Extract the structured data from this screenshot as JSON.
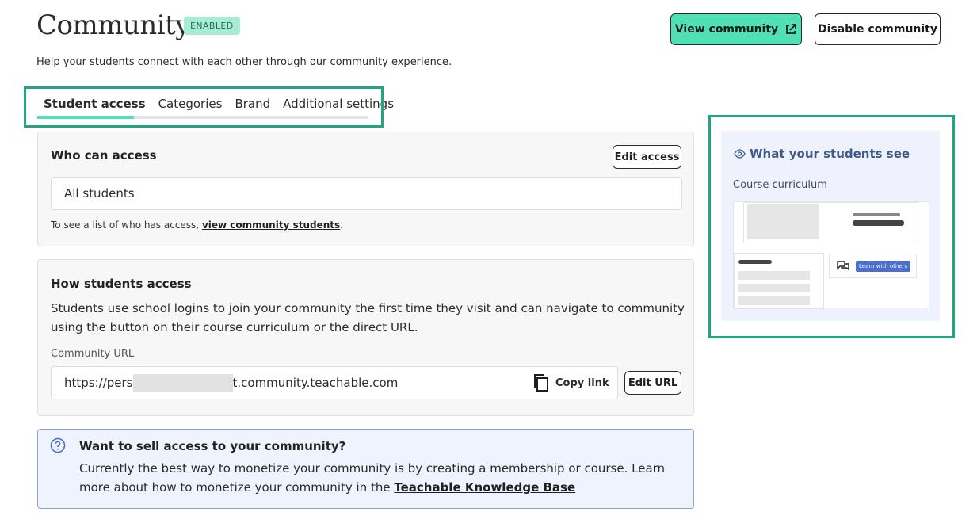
{
  "header": {
    "title": "Community",
    "badge": "ENABLED",
    "subtitle": "Help your students connect with each other through our community experience.",
    "view_button": "View community",
    "disable_button": "Disable community"
  },
  "tabs": [
    {
      "label": "Student access",
      "active": true
    },
    {
      "label": "Categories",
      "active": false
    },
    {
      "label": "Brand",
      "active": false
    },
    {
      "label": "Additional settings",
      "active": false
    }
  ],
  "who_can_access": {
    "title": "Who can access",
    "edit_button": "Edit access",
    "value": "All students",
    "note_prefix": "To see a list of who has access, ",
    "note_link": "view community students",
    "note_suffix": "."
  },
  "how_students_access": {
    "title": "How students access",
    "description": "Students use school logins to join your community the first time they visit and can navigate to community using the button on their course curriculum or the direct URL.",
    "url_label": "Community URL",
    "url_prefix": "https://pers",
    "url_suffix": "t.community.teachable.com",
    "copy_label": "Copy link",
    "edit_url_button": "Edit URL"
  },
  "info": {
    "title": "Want to sell access to your community?",
    "text_prefix": "Currently the best way to monetize your community is by creating a membership or course. Learn more about how to monetize your community in the ",
    "link": "Teachable Knowledge Base"
  },
  "preview": {
    "title": "What your students see",
    "label": "Course curriculum",
    "pill": "Learn with others"
  },
  "colors": {
    "accent": "#4fe0b5",
    "highlight": "#23a584",
    "info_bg": "#eef3fd",
    "preview_bg": "#eff2fc"
  },
  "icons": [
    "external-link-icon",
    "copy-icon",
    "question-circle-icon",
    "eye-icon",
    "chat-icon"
  ]
}
